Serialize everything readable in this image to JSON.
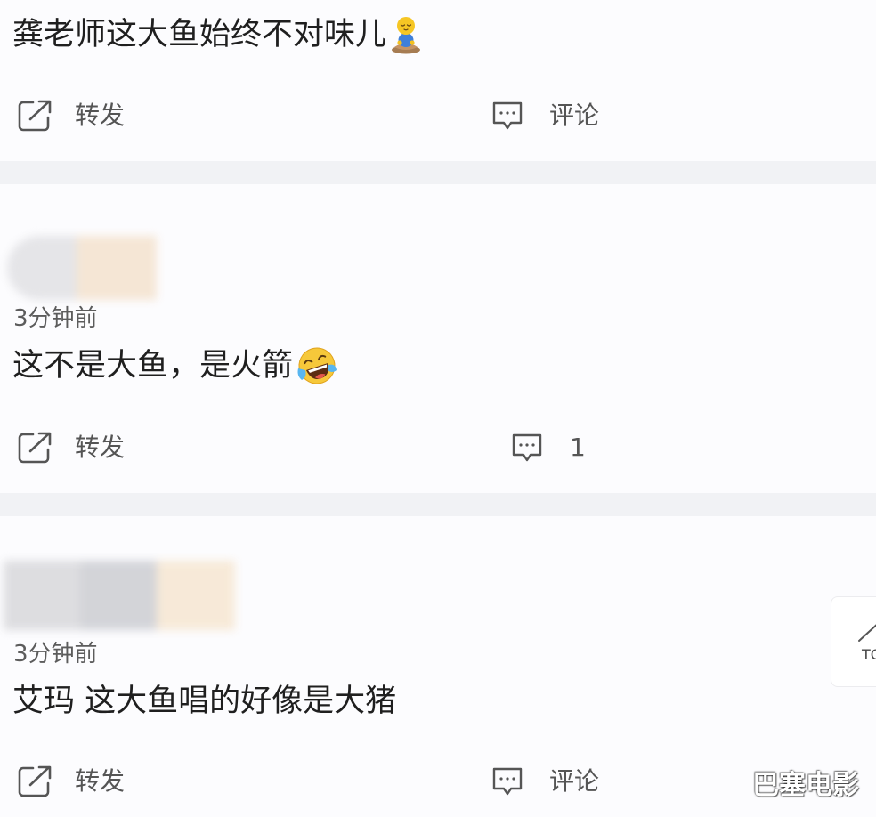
{
  "colors": {
    "page_background": "#f1f2f5",
    "card_background": "#fcfcfe",
    "text_primary": "#1f1f1f",
    "text_secondary": "#5c5c5c",
    "icon_color": "#555555",
    "watermark_color": "#ffffff"
  },
  "comments": [
    {
      "text": "龚老师这大鱼始终不对味儿",
      "emoji": "meditate-emoji",
      "share_icon": "share-icon",
      "share_label": "转发",
      "comment_icon": "comment-icon",
      "comment_label": "评论"
    },
    {
      "time": "3分钟前",
      "text": "这不是大鱼，是火箭",
      "emoji": "laugh-cry-emoji",
      "share_icon": "share-icon",
      "share_label": "转发",
      "comment_icon": "comment-icon",
      "comment_label": "1"
    },
    {
      "time": "3分钟前",
      "text": "艾玛 这大鱼唱的好像是大猪",
      "share_icon": "share-icon",
      "share_label": "转发",
      "comment_icon": "comment-icon",
      "comment_label": "评论"
    }
  ],
  "back_to_top": {
    "icon": "arrow-up-icon",
    "label": "TO"
  },
  "watermark": {
    "text": "巴塞电影"
  }
}
